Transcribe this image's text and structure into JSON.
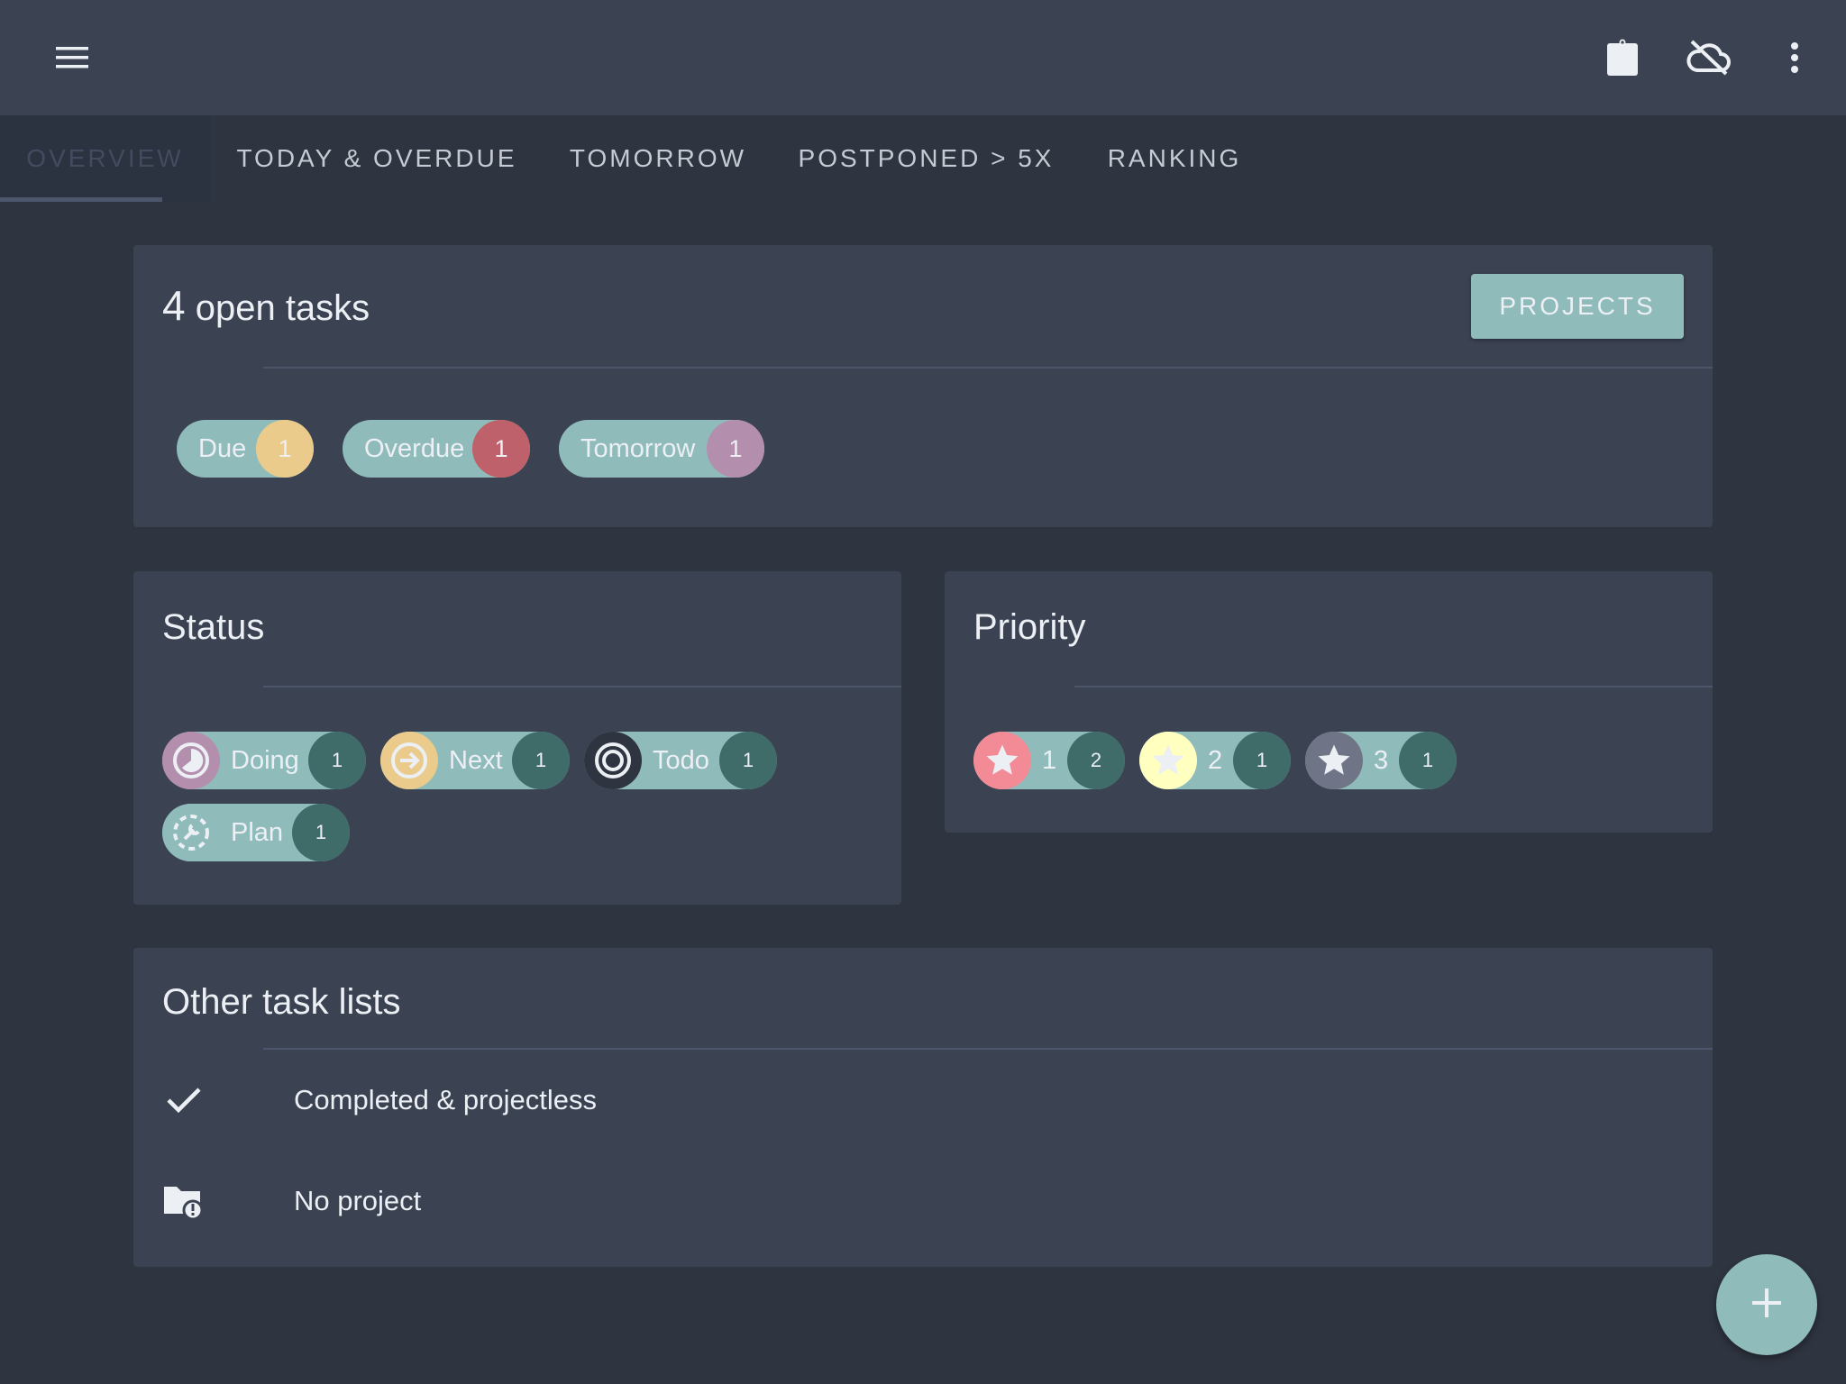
{
  "appbar": {
    "menu_icon": "hamburger-menu-icon",
    "actions": [
      "clipboard-icon",
      "cloud-off-icon",
      "more-vertical-icon"
    ]
  },
  "tabs": [
    {
      "label": "OVERVIEW",
      "active": true
    },
    {
      "label": "TODAY & OVERDUE",
      "active": false
    },
    {
      "label": "TOMORROW",
      "active": false
    },
    {
      "label": "POSTPONED > 5X",
      "active": false
    },
    {
      "label": "RANKING",
      "active": false
    }
  ],
  "summary": {
    "count": "4",
    "title_suffix": "open tasks",
    "projects_button": "PROJECTS",
    "chips": [
      {
        "label": "Due",
        "count": "1",
        "color": "#ebcb8b"
      },
      {
        "label": "Overdue",
        "count": "1",
        "color": "#bf616a"
      },
      {
        "label": "Tomorrow",
        "count": "1",
        "color": "#b48ead"
      }
    ]
  },
  "status": {
    "title": "Status",
    "chips": [
      {
        "label": "Doing",
        "count": "1",
        "icon": "pie-progress-icon",
        "color": "#b48ead"
      },
      {
        "label": "Next",
        "count": "1",
        "icon": "arrow-right-circle-icon",
        "color": "#ebcb8b"
      },
      {
        "label": "Todo",
        "count": "1",
        "icon": "target-icon",
        "color": "#2e3440"
      },
      {
        "label": "Plan",
        "count": "1",
        "icon": "wrench-circle-icon",
        "color": "#8fbcbb"
      }
    ]
  },
  "priority": {
    "title": "Priority",
    "chips": [
      {
        "label": "1",
        "count": "2",
        "icon": "star-icon",
        "color": "#f28b95"
      },
      {
        "label": "2",
        "count": "1",
        "icon": "star-icon",
        "color": "#ffffc0"
      },
      {
        "label": "3",
        "count": "1",
        "icon": "star-icon",
        "color": "#6f7586"
      }
    ]
  },
  "other_lists": {
    "title": "Other task lists",
    "items": [
      {
        "label": "Completed & projectless",
        "icon": "check-icon"
      },
      {
        "label": "No project",
        "icon": "folder-alert-icon"
      }
    ]
  },
  "fab": {
    "icon": "plus-icon"
  }
}
